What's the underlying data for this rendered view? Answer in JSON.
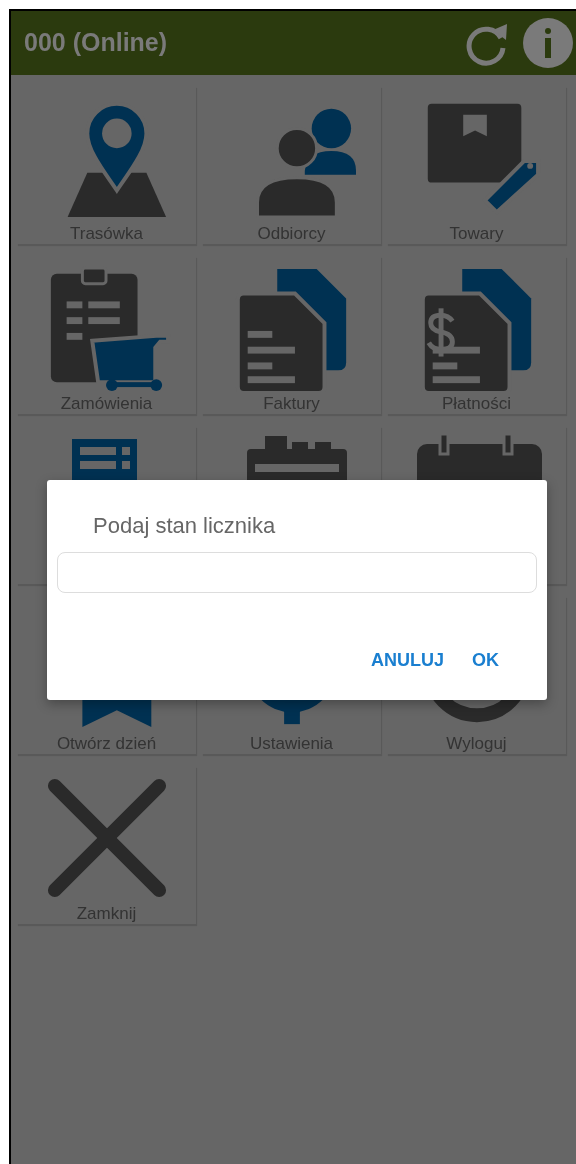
{
  "header": {
    "title": "000 (Online)"
  },
  "tiles": [
    {
      "kind": "route",
      "label": "Trasówka"
    },
    {
      "kind": "customers",
      "label": "Odbiorcy"
    },
    {
      "kind": "goods",
      "label": "Towary"
    },
    {
      "kind": "orders",
      "label": "Zamówienia"
    },
    {
      "kind": "invoices",
      "label": "Faktury"
    },
    {
      "kind": "payments",
      "label": "Płatności"
    },
    {
      "kind": "ledger"
    },
    {
      "kind": "planner"
    },
    {
      "kind": "calendar"
    },
    {
      "kind": "openday",
      "label": "Otwórz dzień"
    },
    {
      "kind": "settings",
      "label": "Ustawienia"
    },
    {
      "kind": "logout",
      "label": "Wyloguj"
    },
    {
      "kind": "close",
      "label": "Zamknij"
    }
  ],
  "dialog": {
    "title": "Podaj stan licznika",
    "buttons": [
      "ANULUJ",
      "OK"
    ]
  }
}
